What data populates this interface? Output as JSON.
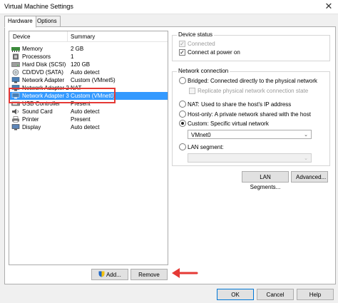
{
  "window": {
    "title": "Virtual Machine Settings",
    "close_glyph": "✕"
  },
  "tabs": [
    {
      "label": "Hardware",
      "active": true
    },
    {
      "label": "Options",
      "active": false
    }
  ],
  "device_list": {
    "headers": {
      "device": "Device",
      "summary": "Summary"
    },
    "rows": [
      {
        "device": "Memory",
        "summary": "2 GB",
        "icon": "memory-icon"
      },
      {
        "device": "Processors",
        "summary": "1",
        "icon": "processor-icon"
      },
      {
        "device": "Hard Disk (SCSI)",
        "summary": "120 GB",
        "icon": "hard-disk-icon"
      },
      {
        "device": "CD/DVD (SATA)",
        "summary": "Auto detect",
        "icon": "cd-dvd-icon"
      },
      {
        "device": "Network Adapter",
        "summary": "Custom (VMnet5)",
        "icon": "network-adapter-icon"
      },
      {
        "device": "Network Adapter 2",
        "summary": "NAT",
        "icon": "network-adapter-icon"
      },
      {
        "device": "Network Adapter 3",
        "summary": "Custom (VMnet0)",
        "icon": "network-adapter-icon",
        "selected": true
      },
      {
        "device": "USB Controller",
        "summary": "Present",
        "icon": "usb-controller-icon"
      },
      {
        "device": "Sound Card",
        "summary": "Auto detect",
        "icon": "sound-card-icon"
      },
      {
        "device": "Printer",
        "summary": "Present",
        "icon": "printer-icon"
      },
      {
        "device": "Display",
        "summary": "Auto detect",
        "icon": "display-icon"
      }
    ]
  },
  "device_status": {
    "title": "Device status",
    "connected_label": "Connected",
    "connect_power_label": "Connect at power on"
  },
  "network_connection": {
    "title": "Network connection",
    "bridged_label": "Bridged: Connected directly to the physical network",
    "replicate_label": "Replicate physical network connection state",
    "nat_label": "NAT: Used to share the host's IP address",
    "hostonly_label": "Host-only: A private network shared with the host",
    "custom_label": "Custom: Specific virtual network",
    "custom_value": "VMnet0",
    "lan_label": "LAN segment:",
    "lan_value": ""
  },
  "buttons": {
    "lan_segments": "LAN Segments...",
    "advanced": "Advanced...",
    "add": "Add...",
    "remove": "Remove",
    "ok": "OK",
    "cancel": "Cancel",
    "help": "Help"
  },
  "colors": {
    "selection": "#3399ff",
    "highlight": "#e53935",
    "arrow": "#e53935"
  }
}
